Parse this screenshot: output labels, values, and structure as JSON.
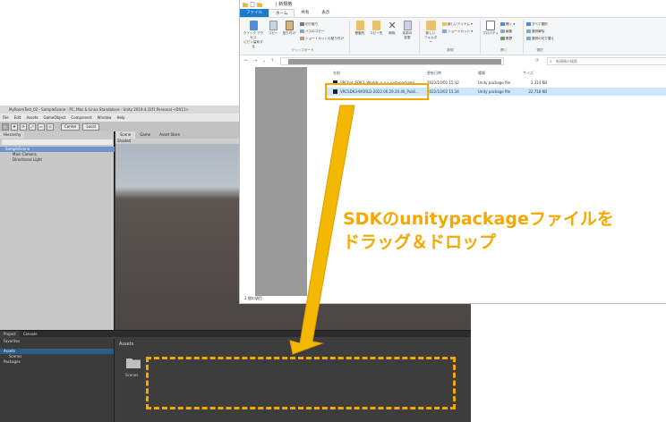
{
  "unity": {
    "title": "MyRoomTest_02 - SampleScene - PC, Mac & Linux Standalone - Unity 2019.4.31f1 Personal <DX11>",
    "menu": [
      "File",
      "Edit",
      "Assets",
      "GameObject",
      "Component",
      "Window",
      "Help"
    ],
    "pivot_label": "Center",
    "space_label": "Local",
    "hierarchy": {
      "tab": "Hierarchy",
      "items": [
        "SampleScene",
        "Main Camera",
        "Directional Light"
      ]
    },
    "scene_tabs": [
      "Scene",
      "Game",
      "Asset Store"
    ],
    "shading_mode": "Shaded",
    "project": {
      "tabs": [
        "Project",
        "Console"
      ],
      "tree": [
        "Favorites",
        "Assets",
        "Scenes",
        "Packages"
      ],
      "header": "Assets",
      "folder_label": "Scenes"
    }
  },
  "explorer": {
    "title": "| 新規格",
    "tabs": [
      "ファイル",
      "ホーム",
      "共有",
      "表示"
    ],
    "ribbon": {
      "pin_label": "クイック アクセス\nにピン留めする",
      "copy_label": "コピー",
      "paste_label": "貼り付け",
      "cut_label": "切り取り",
      "copy_path_label": "パスのコピー",
      "paste_shortcut_label": "ショートカットの貼り付け",
      "clipboard_group": "クリップボード",
      "move_label": "移動先",
      "copyto_label": "コピー先",
      "delete_label": "削除",
      "rename_label": "名前の\n変更",
      "new_folder_label": "新しい\nフォルダー",
      "new_item_label": "新しいアイテム ▾",
      "shortcut_label": "ショートカット ▾",
      "new_group": "新規",
      "properties_label": "プロパティ",
      "open_label": "開く ▾",
      "edit_label": "編集",
      "history_label": "履歴",
      "open_group": "開く",
      "select_all_label": "すべて選択",
      "select_none_label": "選択解除",
      "invert_label": "選択の切り替え",
      "select_group": "選択"
    },
    "search_placeholder": "新規格の検索",
    "columns": {
      "name": "名前",
      "date": "更新日時",
      "type": "種類",
      "size": "サイズ"
    },
    "files": [
      {
        "name": "VRChat_SDK3_Worlds_x.x.x.unitypackage",
        "date": "2022/10/02 15:32",
        "type": "Unity package file",
        "size": "3,314 KB"
      },
      {
        "name": "VRCSDK3-WORLD-2022.06.29.20.46_Publi...",
        "date": "2022/10/02 15:34",
        "type": "Unity package file",
        "size": "22,718 KB"
      }
    ],
    "status": "2 個の項目"
  },
  "caption": {
    "line1": "SDKのunitypackageファイルを",
    "line2": "ドラッグ＆ドロップ"
  },
  "colors": {
    "accent": "#f5a800",
    "file_tab": "#1979ca",
    "selection": "#cce8ff"
  }
}
